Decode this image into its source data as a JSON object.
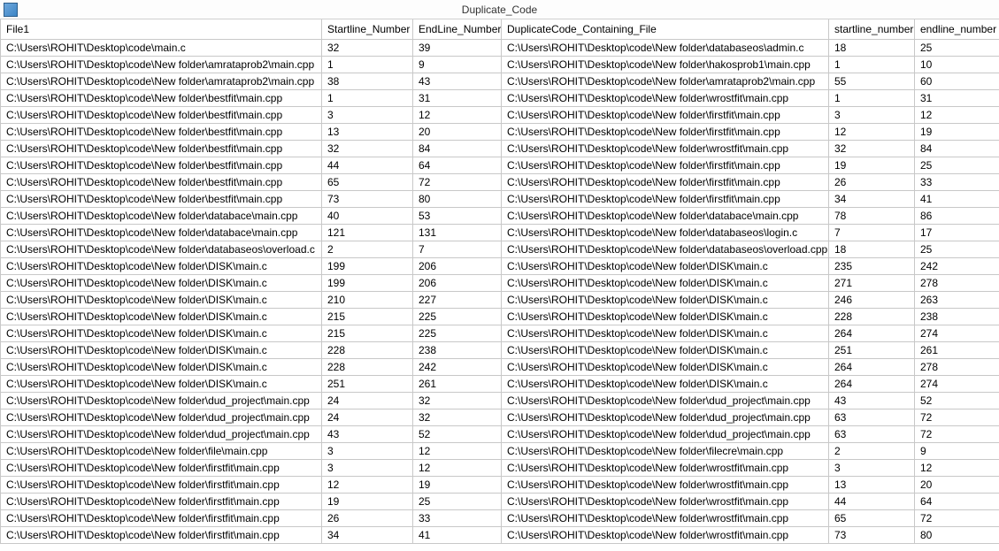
{
  "window": {
    "title": "Duplicate_Code"
  },
  "columns": [
    "File1",
    "Startline_Number",
    "EndLine_Number",
    "DuplicateCode_Containing_File",
    "startline_number",
    "endline_number"
  ],
  "rows": [
    [
      "C:\\Users\\ROHIT\\Desktop\\code\\main.c",
      "32",
      "39",
      "C:\\Users\\ROHIT\\Desktop\\code\\New folder\\databaseos\\admin.c",
      "18",
      "25"
    ],
    [
      "C:\\Users\\ROHIT\\Desktop\\code\\New folder\\amrataprob2\\main.cpp",
      "1",
      "9",
      "C:\\Users\\ROHIT\\Desktop\\code\\New folder\\hakosprob1\\main.cpp",
      "1",
      "10"
    ],
    [
      "C:\\Users\\ROHIT\\Desktop\\code\\New folder\\amrataprob2\\main.cpp",
      "38",
      "43",
      "C:\\Users\\ROHIT\\Desktop\\code\\New folder\\amrataprob2\\main.cpp",
      "55",
      "60"
    ],
    [
      "C:\\Users\\ROHIT\\Desktop\\code\\New folder\\bestfit\\main.cpp",
      "1",
      "31",
      "C:\\Users\\ROHIT\\Desktop\\code\\New folder\\wrostfit\\main.cpp",
      "1",
      "31"
    ],
    [
      "C:\\Users\\ROHIT\\Desktop\\code\\New folder\\bestfit\\main.cpp",
      "3",
      "12",
      "C:\\Users\\ROHIT\\Desktop\\code\\New folder\\firstfit\\main.cpp",
      "3",
      "12"
    ],
    [
      "C:\\Users\\ROHIT\\Desktop\\code\\New folder\\bestfit\\main.cpp",
      "13",
      "20",
      "C:\\Users\\ROHIT\\Desktop\\code\\New folder\\firstfit\\main.cpp",
      "12",
      "19"
    ],
    [
      "C:\\Users\\ROHIT\\Desktop\\code\\New folder\\bestfit\\main.cpp",
      "32",
      "84",
      "C:\\Users\\ROHIT\\Desktop\\code\\New folder\\wrostfit\\main.cpp",
      "32",
      "84"
    ],
    [
      "C:\\Users\\ROHIT\\Desktop\\code\\New folder\\bestfit\\main.cpp",
      "44",
      "64",
      "C:\\Users\\ROHIT\\Desktop\\code\\New folder\\firstfit\\main.cpp",
      "19",
      "25"
    ],
    [
      "C:\\Users\\ROHIT\\Desktop\\code\\New folder\\bestfit\\main.cpp",
      "65",
      "72",
      "C:\\Users\\ROHIT\\Desktop\\code\\New folder\\firstfit\\main.cpp",
      "26",
      "33"
    ],
    [
      "C:\\Users\\ROHIT\\Desktop\\code\\New folder\\bestfit\\main.cpp",
      "73",
      "80",
      "C:\\Users\\ROHIT\\Desktop\\code\\New folder\\firstfit\\main.cpp",
      "34",
      "41"
    ],
    [
      "C:\\Users\\ROHIT\\Desktop\\code\\New folder\\databace\\main.cpp",
      "40",
      "53",
      "C:\\Users\\ROHIT\\Desktop\\code\\New folder\\databace\\main.cpp",
      "78",
      "86"
    ],
    [
      "C:\\Users\\ROHIT\\Desktop\\code\\New folder\\databace\\main.cpp",
      "121",
      "131",
      "C:\\Users\\ROHIT\\Desktop\\code\\New folder\\databaseos\\login.c",
      "7",
      "17"
    ],
    [
      "C:\\Users\\ROHIT\\Desktop\\code\\New folder\\databaseos\\overload.c",
      "2",
      "7",
      "C:\\Users\\ROHIT\\Desktop\\code\\New folder\\databaseos\\overload.cpp",
      "18",
      "25"
    ],
    [
      "C:\\Users\\ROHIT\\Desktop\\code\\New folder\\DISK\\main.c",
      "199",
      "206",
      "C:\\Users\\ROHIT\\Desktop\\code\\New folder\\DISK\\main.c",
      "235",
      "242"
    ],
    [
      "C:\\Users\\ROHIT\\Desktop\\code\\New folder\\DISK\\main.c",
      "199",
      "206",
      "C:\\Users\\ROHIT\\Desktop\\code\\New folder\\DISK\\main.c",
      "271",
      "278"
    ],
    [
      "C:\\Users\\ROHIT\\Desktop\\code\\New folder\\DISK\\main.c",
      "210",
      "227",
      "C:\\Users\\ROHIT\\Desktop\\code\\New folder\\DISK\\main.c",
      "246",
      "263"
    ],
    [
      "C:\\Users\\ROHIT\\Desktop\\code\\New folder\\DISK\\main.c",
      "215",
      "225",
      "C:\\Users\\ROHIT\\Desktop\\code\\New folder\\DISK\\main.c",
      "228",
      "238"
    ],
    [
      "C:\\Users\\ROHIT\\Desktop\\code\\New folder\\DISK\\main.c",
      "215",
      "225",
      "C:\\Users\\ROHIT\\Desktop\\code\\New folder\\DISK\\main.c",
      "264",
      "274"
    ],
    [
      "C:\\Users\\ROHIT\\Desktop\\code\\New folder\\DISK\\main.c",
      "228",
      "238",
      "C:\\Users\\ROHIT\\Desktop\\code\\New folder\\DISK\\main.c",
      "251",
      "261"
    ],
    [
      "C:\\Users\\ROHIT\\Desktop\\code\\New folder\\DISK\\main.c",
      "228",
      "242",
      "C:\\Users\\ROHIT\\Desktop\\code\\New folder\\DISK\\main.c",
      "264",
      "278"
    ],
    [
      "C:\\Users\\ROHIT\\Desktop\\code\\New folder\\DISK\\main.c",
      "251",
      "261",
      "C:\\Users\\ROHIT\\Desktop\\code\\New folder\\DISK\\main.c",
      "264",
      "274"
    ],
    [
      "C:\\Users\\ROHIT\\Desktop\\code\\New folder\\dud_project\\main.cpp",
      "24",
      "32",
      "C:\\Users\\ROHIT\\Desktop\\code\\New folder\\dud_project\\main.cpp",
      "43",
      "52"
    ],
    [
      "C:\\Users\\ROHIT\\Desktop\\code\\New folder\\dud_project\\main.cpp",
      "24",
      "32",
      "C:\\Users\\ROHIT\\Desktop\\code\\New folder\\dud_project\\main.cpp",
      "63",
      "72"
    ],
    [
      "C:\\Users\\ROHIT\\Desktop\\code\\New folder\\dud_project\\main.cpp",
      "43",
      "52",
      "C:\\Users\\ROHIT\\Desktop\\code\\New folder\\dud_project\\main.cpp",
      "63",
      "72"
    ],
    [
      "C:\\Users\\ROHIT\\Desktop\\code\\New folder\\file\\main.cpp",
      "3",
      "12",
      "C:\\Users\\ROHIT\\Desktop\\code\\New folder\\filecre\\main.cpp",
      "2",
      "9"
    ],
    [
      "C:\\Users\\ROHIT\\Desktop\\code\\New folder\\firstfit\\main.cpp",
      "3",
      "12",
      "C:\\Users\\ROHIT\\Desktop\\code\\New folder\\wrostfit\\main.cpp",
      "3",
      "12"
    ],
    [
      "C:\\Users\\ROHIT\\Desktop\\code\\New folder\\firstfit\\main.cpp",
      "12",
      "19",
      "C:\\Users\\ROHIT\\Desktop\\code\\New folder\\wrostfit\\main.cpp",
      "13",
      "20"
    ],
    [
      "C:\\Users\\ROHIT\\Desktop\\code\\New folder\\firstfit\\main.cpp",
      "19",
      "25",
      "C:\\Users\\ROHIT\\Desktop\\code\\New folder\\wrostfit\\main.cpp",
      "44",
      "64"
    ],
    [
      "C:\\Users\\ROHIT\\Desktop\\code\\New folder\\firstfit\\main.cpp",
      "26",
      "33",
      "C:\\Users\\ROHIT\\Desktop\\code\\New folder\\wrostfit\\main.cpp",
      "65",
      "72"
    ],
    [
      "C:\\Users\\ROHIT\\Desktop\\code\\New folder\\firstfit\\main.cpp",
      "34",
      "41",
      "C:\\Users\\ROHIT\\Desktop\\code\\New folder\\wrostfit\\main.cpp",
      "73",
      "80"
    ]
  ]
}
